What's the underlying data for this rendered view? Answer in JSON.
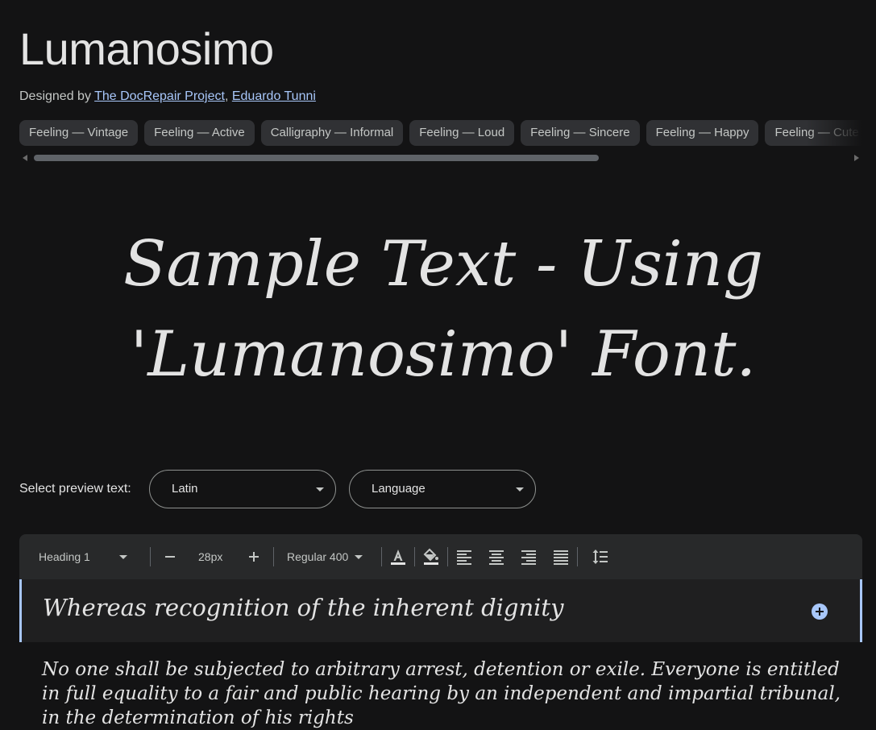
{
  "font": {
    "name": "Lumanosimo",
    "designed_by_label": "Designed by",
    "designers": [
      "The DocRepair Project",
      "Eduardo Tunni"
    ]
  },
  "tags": [
    "Feeling — Vintage",
    "Feeling — Active",
    "Calligraphy — Informal",
    "Feeling — Loud",
    "Feeling — Sincere",
    "Feeling — Happy",
    "Feeling — Cute"
  ],
  "sample_text": "Sample Text - Using 'Lumanosimo' Font.",
  "preview": {
    "label": "Select preview text:",
    "script_value": "Latin",
    "language_placeholder": "Language"
  },
  "toolbar": {
    "style": "Heading 1",
    "size": "28px",
    "weight": "Regular 400",
    "icons": [
      "minus-icon",
      "plus-icon",
      "text-color-icon",
      "highlight-color-icon",
      "align-left-icon",
      "align-center-icon",
      "align-right-icon",
      "align-justify-icon",
      "line-height-icon"
    ]
  },
  "heading_sample": "Whereas recognition of the inherent dignity",
  "body_sample": "No one shall be subjected to arbitrary arrest, detention or exile. Everyone is entitled in full equality to a fair and public hearing by an independent and impartial tribunal, in the determination of his rights",
  "colors": {
    "background": "#131314",
    "accent": "#a8c7fa",
    "chip": "#303134"
  }
}
